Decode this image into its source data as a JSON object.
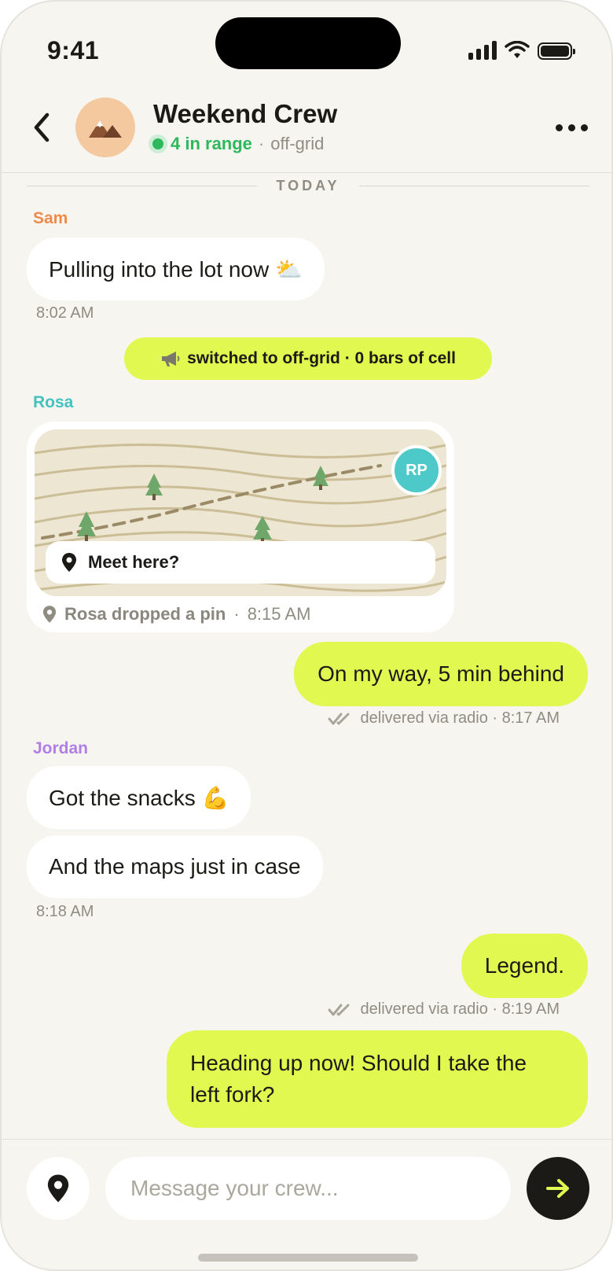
{
  "status_bar": {
    "time": "9:41"
  },
  "header": {
    "title": "Weekend Crew",
    "in_range": "4 in range",
    "separator": "·",
    "mode": "off-grid"
  },
  "chat": {
    "day_label": "TODAY",
    "sam": {
      "sender": "Sam",
      "sender_color": "#f08a4b",
      "text": "Pulling into the lot now ⛅",
      "time": "8:02 AM"
    },
    "system_event": {
      "icon": "megaphone",
      "text": "switched to off-grid · 0 bars of cell"
    },
    "rosa": {
      "sender": "Rosa",
      "sender_color": "#43c2c0",
      "pin_avatar": "RP",
      "pin_label": "Meet here?",
      "meta_who": "Rosa dropped a pin",
      "meta_sep": "·",
      "time": "8:15 AM"
    },
    "out_1": {
      "text": "On my way, 5 min behind",
      "receipt": "delivered via radio · 8:17 AM"
    },
    "jordan": {
      "sender": "Jordan",
      "sender_color": "#b07ee6",
      "text_1": "Got the snacks 💪",
      "text_2": "And the maps just in case",
      "time": "8:18 AM"
    },
    "out_2": {
      "text": "Legend.",
      "receipt": "delivered via radio · 8:19 AM"
    },
    "out_3": {
      "line_1": "Heading up now! Should I take the",
      "line_2": "left fork?"
    }
  },
  "composer": {
    "placeholder": "Message your crew..."
  },
  "colors": {
    "accent": "#e0f84f",
    "online": "#2eb85c",
    "background": "#f6f5ef"
  }
}
